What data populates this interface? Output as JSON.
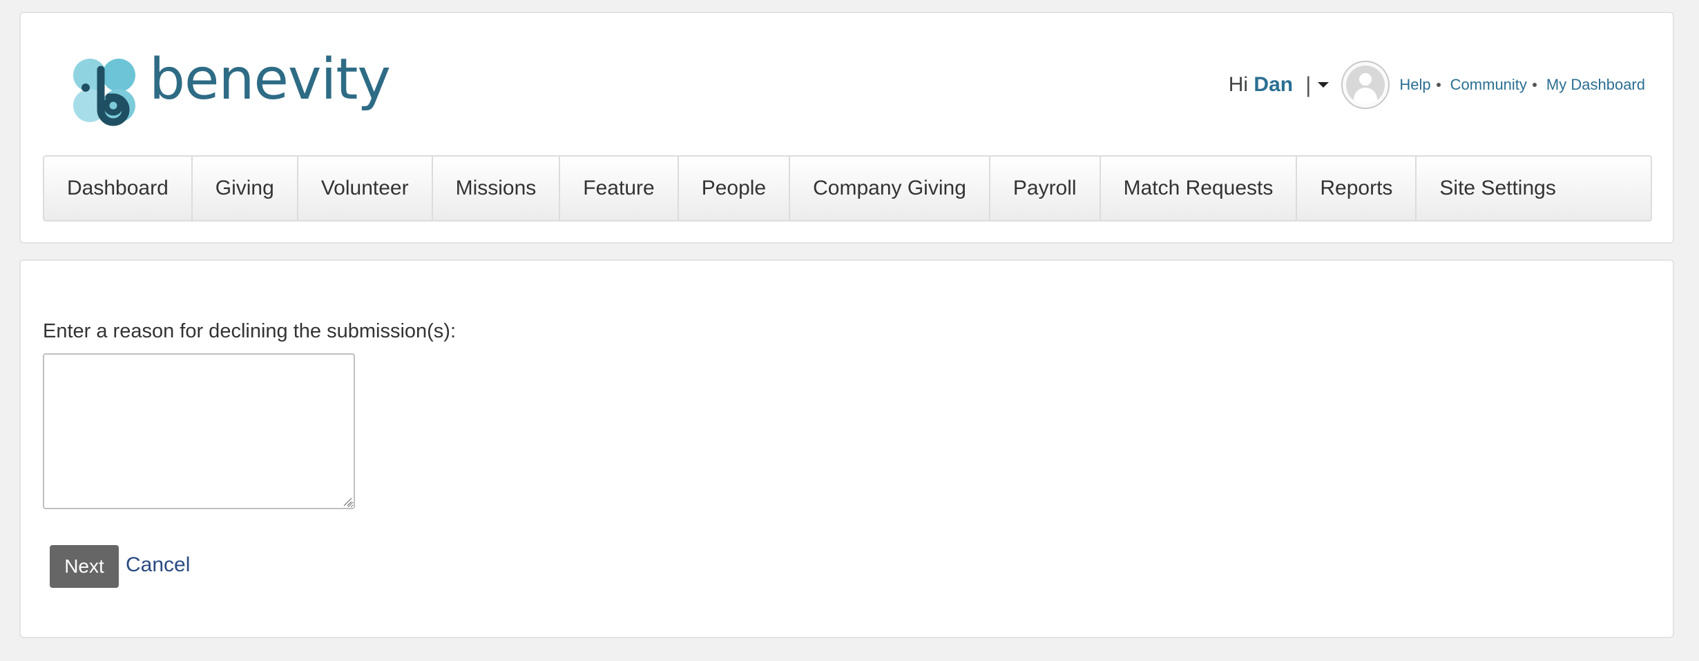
{
  "brand": {
    "name": "benevity",
    "colors": {
      "logo_light": "#8fd3e0",
      "logo_dark": "#1f4f63",
      "text": "#2e6b85",
      "link": "#2b6f92"
    }
  },
  "user": {
    "greeting": "Hi",
    "name": "Dan",
    "separator": "|",
    "avatar_icon": "user-avatar-icon"
  },
  "top_links": [
    {
      "label": "Help"
    },
    {
      "label": "Community"
    },
    {
      "label": "My Dashboard"
    }
  ],
  "nav": {
    "items": [
      {
        "label": "Dashboard"
      },
      {
        "label": "Giving"
      },
      {
        "label": "Volunteer"
      },
      {
        "label": "Missions"
      },
      {
        "label": "Feature"
      },
      {
        "label": "People"
      },
      {
        "label": "Company Giving"
      },
      {
        "label": "Payroll"
      },
      {
        "label": "Match Requests"
      },
      {
        "label": "Reports"
      },
      {
        "label": "Site Settings"
      }
    ]
  },
  "form": {
    "reason_label": "Enter a reason for declining the submission(s):",
    "reason_value": "",
    "next_label": "Next",
    "cancel_label": "Cancel",
    "next_button_color": "#666666"
  }
}
